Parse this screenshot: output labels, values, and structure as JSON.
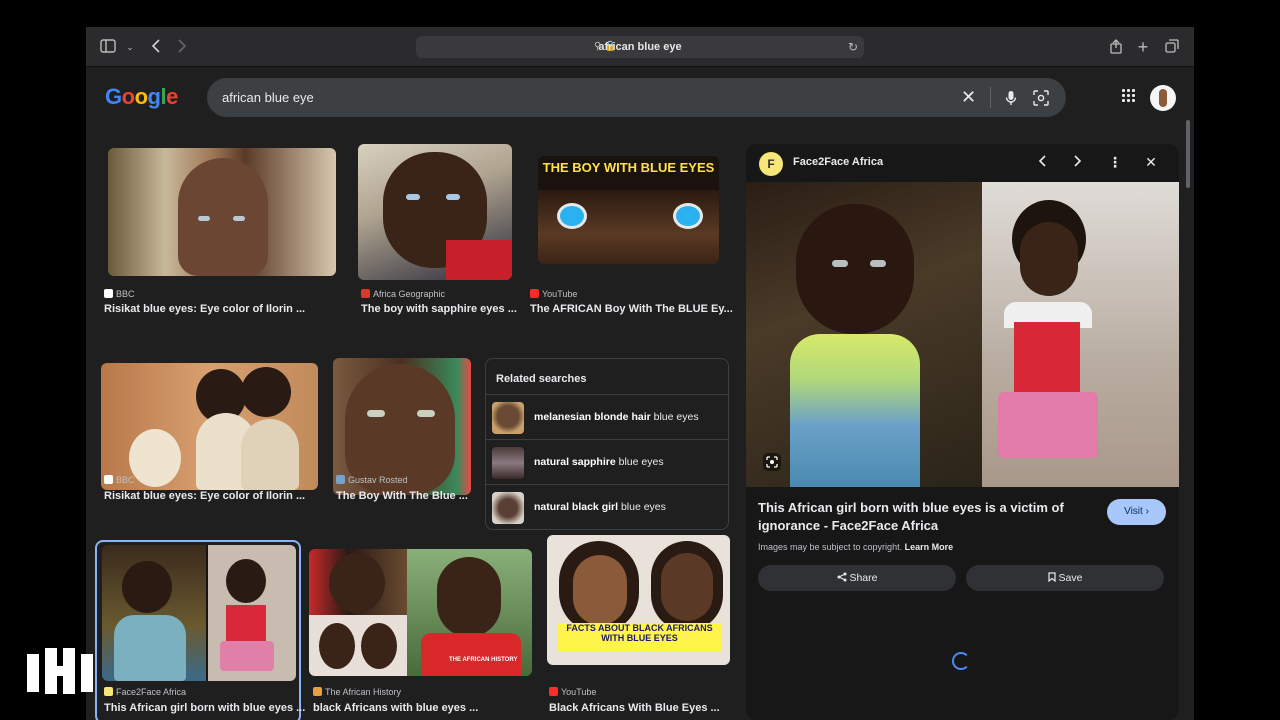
{
  "browser": {
    "url": "african blue eye"
  },
  "search": {
    "query": "african blue eye",
    "logo_letters": [
      "G",
      "o",
      "o",
      "g",
      "l",
      "e"
    ],
    "colors": {
      "blue": "#4285f4",
      "red": "#ea4335",
      "yellow": "#fbbc05",
      "green": "#34a853"
    }
  },
  "results": [
    {
      "source": "BBC",
      "title": "Risikat blue eyes: Eye color of Ilorin ..."
    },
    {
      "source": "Africa Geographic",
      "title": "The boy with sapphire eyes ..."
    },
    {
      "source": "YouTube",
      "title": "The AFRICAN Boy With The BLUE Ey...",
      "overlay": "THE BOY WITH BLUE EYES"
    },
    {
      "source": "BBC",
      "title": "Risikat blue eyes: Eye color of Ilorin ..."
    },
    {
      "source": "Gustav Rosted",
      "title": "The Boy With The Blue ..."
    },
    {
      "source": "Face2Face Africa",
      "title": "This African girl born with blue eyes ..."
    },
    {
      "source": "The African History",
      "title": "black Africans with blue eyes ..."
    },
    {
      "source": "YouTube",
      "title": "Black Africans With Blue Eyes ...",
      "overlay": "FACTS ABOUT BLACK AFRICANS WITH BLUE EYES"
    }
  ],
  "related": {
    "title": "Related searches",
    "items": [
      {
        "bold": "melanesian blonde hair",
        "rest": " blue eyes"
      },
      {
        "bold": "natural sapphire",
        "rest": " blue eyes"
      },
      {
        "bold": "natural black girl",
        "rest": " blue eyes"
      }
    ]
  },
  "panel": {
    "source": "Face2Face Africa",
    "favicon_letter": "F",
    "title": "This African girl born with blue eyes is a victim of ignorance - Face2Face Africa",
    "visit_label": "Visit",
    "copyright": "Images may be subject to copyright.",
    "learn_more": "Learn More",
    "share_label": "Share",
    "save_label": "Save"
  }
}
